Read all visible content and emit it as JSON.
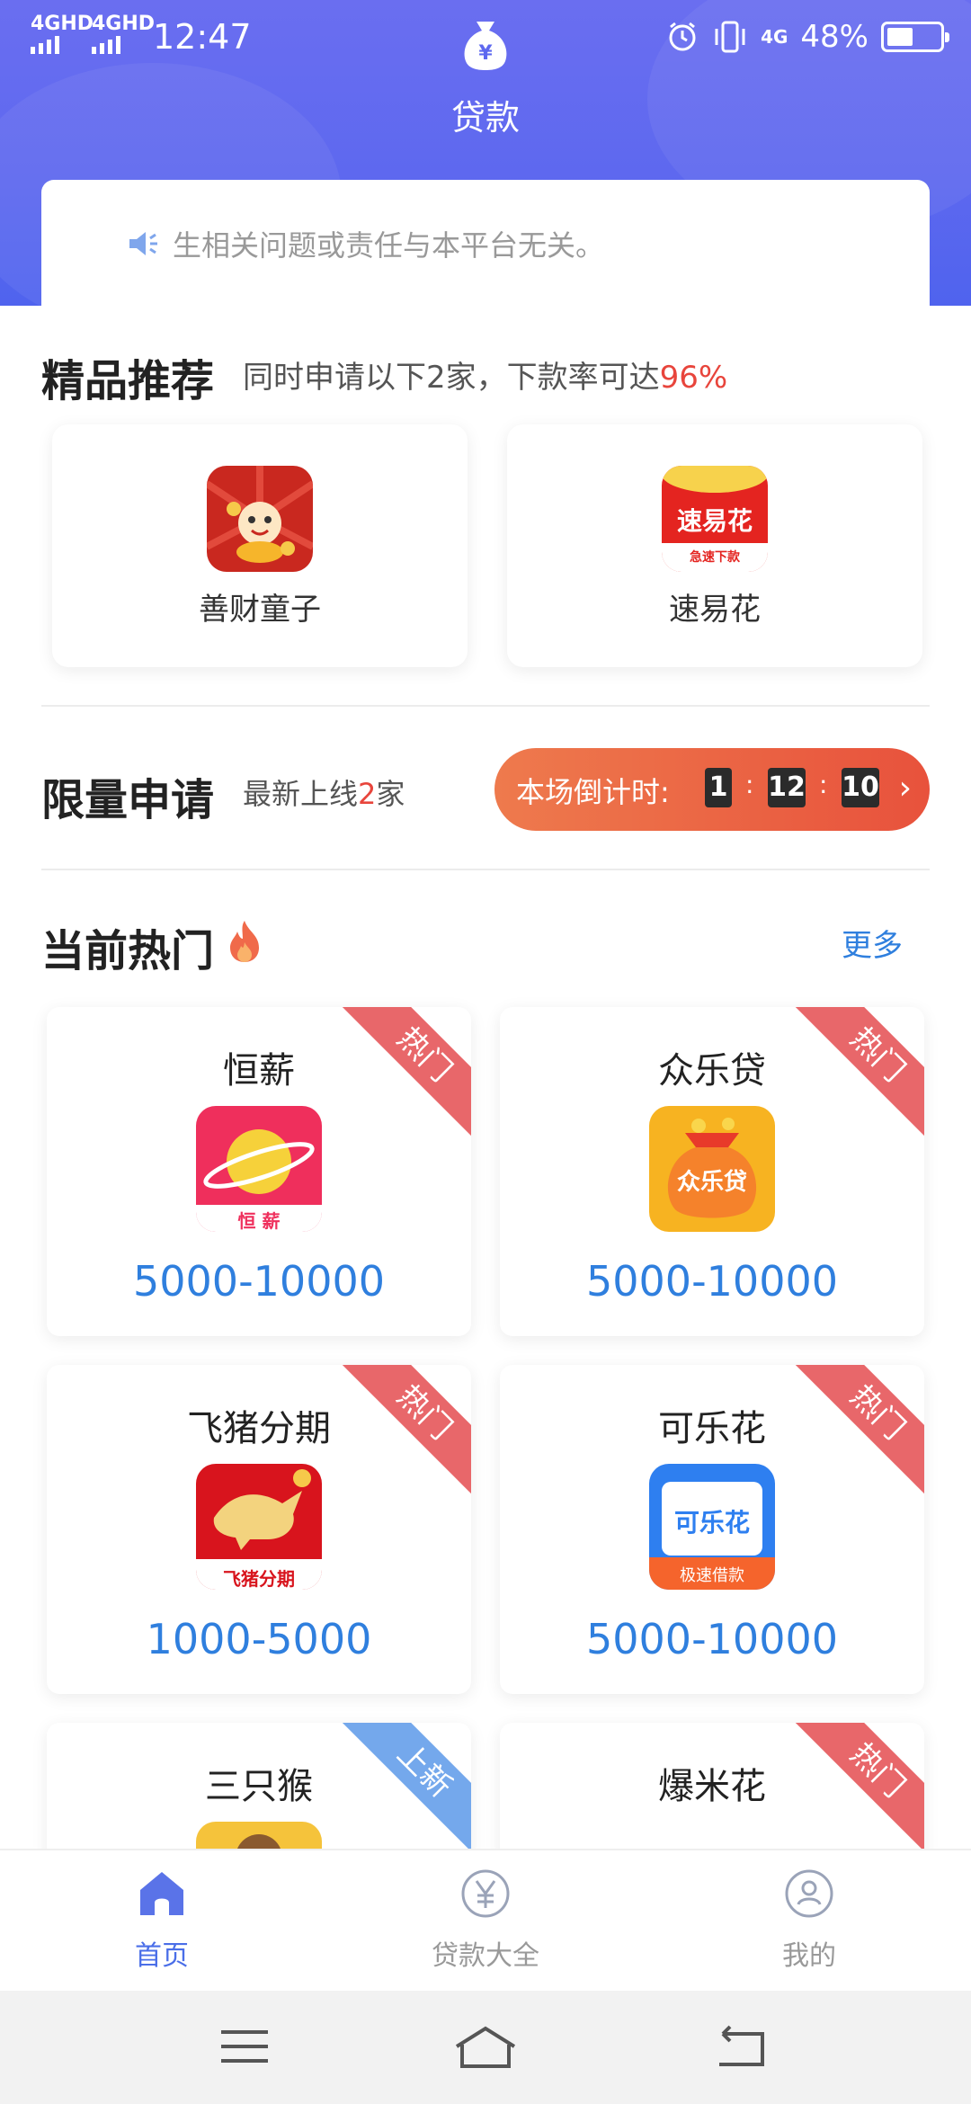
{
  "status_bar": {
    "signal_1": "4GHD",
    "signal_2": "4GHD",
    "time": "12:47",
    "network": "4G",
    "battery": "48%",
    "icons": [
      "alarm-icon",
      "vibrate-icon",
      "battery-icon"
    ]
  },
  "header": {
    "icon": "money-bag-icon",
    "title": "贷款"
  },
  "notice": {
    "icon": "speaker-icon",
    "text": "生相关问题或责任与本平台无关。"
  },
  "featured": {
    "title": "精品推荐",
    "subtitle_prefix": "同时申请以下2家，下款率可达",
    "subtitle_highlight": "96%",
    "items": [
      {
        "name": "善财童子",
        "logo": "shancai-logo"
      },
      {
        "name": "速易花",
        "logo": "suyihua-logo",
        "logo_text": "速易花",
        "logo_sub": "急速下款"
      }
    ]
  },
  "limited": {
    "title": "限量申请",
    "subtitle_prefix": "最新上线",
    "subtitle_highlight": "2",
    "subtitle_suffix": "家",
    "countdown_label": "本场倒计时:",
    "hours": "1",
    "minutes": "12",
    "seconds": "10",
    "arrow": "›"
  },
  "hot": {
    "title": "当前热门",
    "title_icon": "fire-icon",
    "more": "更多",
    "products": [
      {
        "name": "恒薪",
        "range": "5000-10000",
        "tag": "热门",
        "logo": "hengxin-logo",
        "logo_text": "恒 薪"
      },
      {
        "name": "众乐贷",
        "range": "5000-10000",
        "tag": "热门",
        "logo": "zhongledai-logo",
        "logo_text": "众乐贷"
      },
      {
        "name": "飞猪分期",
        "range": "1000-5000",
        "tag": "热门",
        "logo": "feizhu-logo",
        "logo_text": "飞猪分期"
      },
      {
        "name": "可乐花",
        "range": "5000-10000",
        "tag": "热门",
        "logo": "kelehua-logo",
        "logo_text": "可乐花",
        "logo_sub": "极速借款"
      },
      {
        "name": "三只猴",
        "range": "",
        "tag": "上新",
        "logo": "sanzhihou-logo"
      },
      {
        "name": "爆米花",
        "range": "",
        "tag": "热门",
        "logo": "baomihua-logo"
      }
    ]
  },
  "tabbar": {
    "tabs": [
      {
        "label": "首页",
        "icon": "home-icon",
        "active": true
      },
      {
        "label": "贷款大全",
        "icon": "yuan-icon",
        "active": false
      },
      {
        "label": "我的",
        "icon": "user-icon",
        "active": false
      }
    ]
  },
  "colors": {
    "header": "#5d68ef",
    "accent_blue": "#2f7fde",
    "highlight_red": "#e8453c",
    "hot_tag": "#e8676a",
    "new_tag": "#74a8ec"
  }
}
